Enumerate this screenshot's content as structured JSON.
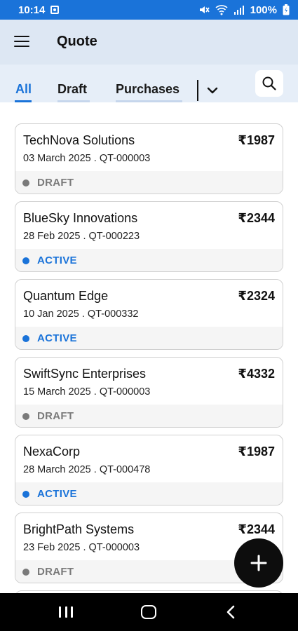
{
  "status_bar": {
    "time": "10:14",
    "battery": "100%",
    "icons": [
      "notification-icon",
      "mute-icon",
      "wifi-icon",
      "signal-icon",
      "battery-charging-icon"
    ]
  },
  "app_bar": {
    "title": "Quote",
    "menu_icon": "hamburger-menu-icon"
  },
  "tabs": [
    {
      "label": "All",
      "active": true
    },
    {
      "label": "Draft",
      "active": false
    },
    {
      "label": "Purchases",
      "active": false
    }
  ],
  "tab_more_icon": "chevron-down-icon",
  "search_icon": "search-icon",
  "colors": {
    "accent": "#1a73d9",
    "active_status": "#1a73d9",
    "draft_status": "#7a7a7a"
  },
  "quotes": [
    {
      "name": "TechNova Solutions",
      "amount": "₹1987",
      "meta": "03 March 2025 . QT-000003",
      "status": "DRAFT"
    },
    {
      "name": "BlueSky Innovations",
      "amount": "₹2344",
      "meta": "28 Feb 2025 . QT-000223",
      "status": "ACTIVE"
    },
    {
      "name": "Quantum Edge",
      "amount": "₹2324",
      "meta": "10 Jan 2025 . QT-000332",
      "status": "ACTIVE"
    },
    {
      "name": "SwiftSync Enterprises",
      "amount": "₹4332",
      "meta": "15 March 2025 . QT-000003",
      "status": "DRAFT"
    },
    {
      "name": "NexaCorp",
      "amount": "₹1987",
      "meta": "28 March 2025 . QT-000478",
      "status": "ACTIVE"
    },
    {
      "name": "BrightPath Systems",
      "amount": "₹2344",
      "meta": "23 Feb 2025 . QT-000003",
      "status": "DRAFT"
    }
  ],
  "fab_icon": "plus-icon",
  "nav": {
    "recents_icon": "recents-icon",
    "home_icon": "home-icon",
    "back_icon": "back-icon"
  }
}
